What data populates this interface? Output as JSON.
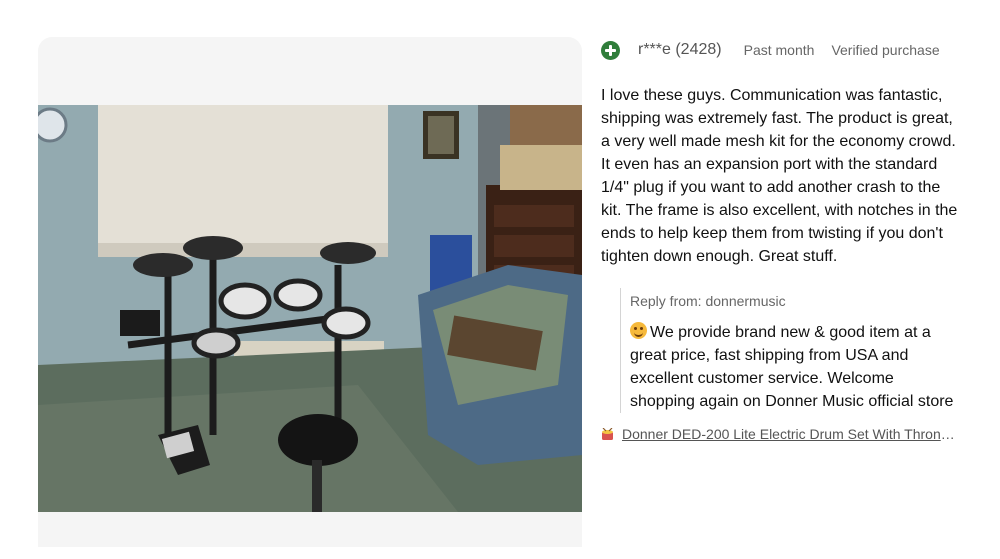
{
  "review": {
    "reviewer": "r***e (2428)",
    "date": "Past month",
    "badge": "Verified purchase",
    "text": "I love these guys. Communication was fantastic, shipping was extremely fast. The product is great, a very well made mesh kit for the economy crowd. It even has an expansion port with the standard 1/4\" plug if you want to add another crash to the kit. The frame is also excellent, with notches in the ends to help keep them from twisting if you don't tighten down enough. Great stuff.",
    "rating_icon": "positive-plus-icon"
  },
  "reply": {
    "label": "Reply from: donnermusic",
    "text": "We provide brand new & good item at a great price, fast shipping from USA and excellent customer service. Welcome shopping again on Donner Music official store",
    "emoji": "smile-emoji"
  },
  "product_link": {
    "text": "Donner DED-200 Lite Electric Drum Set With Throne…",
    "icon": "drum-icon"
  },
  "photo": {
    "alt_subject": "electric-drum-kit-photo"
  },
  "colors": {
    "positive": "#2f7d3a",
    "text": "#111111",
    "muted": "#666666"
  }
}
